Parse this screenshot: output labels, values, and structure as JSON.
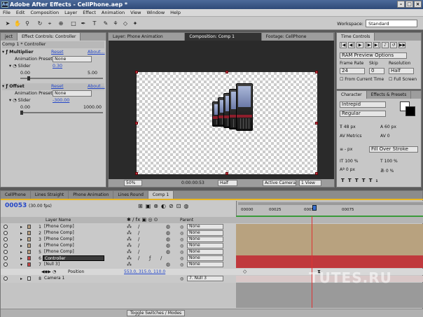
{
  "app": {
    "title": "Adobe After Effects - CellPhone.aep *",
    "icon_text": "Ae"
  },
  "menu": [
    "File",
    "Edit",
    "Composition",
    "Layer",
    "Effect",
    "Animation",
    "View",
    "Window",
    "Help"
  ],
  "workspace": {
    "label": "Workspace:",
    "value": "Standard"
  },
  "effect_controls": {
    "tabs": [
      "ject",
      "Effect Controls: Controller"
    ],
    "header": "Comp 1 * Controller",
    "effects": [
      {
        "name": "Multiplier",
        "reset": "Reset",
        "about": "About...",
        "preset_label": "Animation Presets:",
        "preset_value": "None",
        "param": "Slider",
        "value": "0.30",
        "min": "0.00",
        "max": "5.00"
      },
      {
        "name": "Offset",
        "reset": "Reset",
        "about": "About...",
        "preset_label": "Animation Presets:",
        "preset_value": "None",
        "param": "Slider",
        "value": "-300.00",
        "min": "0.00",
        "max": "1000.00"
      }
    ]
  },
  "viewer": {
    "tabs": [
      "Layer: Phone Animation",
      "Composition: Comp 1",
      "Footage: CellPhone"
    ],
    "zoom": "50%",
    "timecode": "0:00:00:53",
    "resolution": "Half",
    "camera": "Active Camera",
    "views": "1 View"
  },
  "time_controls": {
    "tab": "Time Controls",
    "preview_label": "RAM Preview Options",
    "frame_rate_label": "Frame Rate",
    "skip_label": "Skip",
    "resolution_label": "Resolution",
    "frame_rate": "24",
    "skip": "0",
    "resolution": "Half",
    "from_current": "From Current Time",
    "full_screen": "Full Screen"
  },
  "character": {
    "tabs": [
      "Character",
      "Effects & Presets"
    ],
    "font": "Intrepid",
    "style": "Regular",
    "size": "48 px",
    "leading": "60 px",
    "kerning": "Metrics",
    "tracking": "0",
    "stroke_width": "- px",
    "stroke_mode": "Fill Over Stroke",
    "vscale": "100 %",
    "hscale": "100 %",
    "baseline": "0 px",
    "tsume": "0 %"
  },
  "timeline": {
    "tabs": [
      "CellPhone",
      "Lines Straight",
      "Phone Animation",
      "Lines Round",
      "Comp 1"
    ],
    "time": "00053",
    "fps": "(30.00 fps)",
    "col_layer": "Layer Name",
    "col_parent": "Parent",
    "ruler": [
      "00000",
      "00025",
      "00050",
      "00075"
    ],
    "layers": [
      {
        "num": "1",
        "name": "[Phone Comp]",
        "parent": "None",
        "color": "#b9a182",
        "bar": "#b8a27f"
      },
      {
        "num": "2",
        "name": "[Phone Comp]",
        "parent": "None",
        "color": "#b9a182",
        "bar": "#b8a27f"
      },
      {
        "num": "3",
        "name": "[Phone Comp]",
        "parent": "None",
        "color": "#b9a182",
        "bar": "#b8a27f"
      },
      {
        "num": "4",
        "name": "[Phone Comp]",
        "parent": "None",
        "color": "#b9a182",
        "bar": "#b8a27f"
      },
      {
        "num": "5",
        "name": "[Phone Comp]",
        "parent": "None",
        "color": "#b9a182",
        "bar": "#b8a27f"
      },
      {
        "num": "6",
        "name": "Controller",
        "parent": "None",
        "color": "#c44242",
        "bar": "#c0393d",
        "selected": true
      },
      {
        "num": "7",
        "name": "[Null 3]",
        "parent": "None",
        "color": "#c44242",
        "bar": "#c0393d"
      }
    ],
    "position": {
      "label": "Position",
      "value": "553.0, 315.0, 110.0"
    },
    "camera": {
      "num": "8",
      "name": "Camera 1",
      "parent": "7. Null 3"
    },
    "toggle_label": "Toggle Switches / Modes"
  },
  "watermark": "TUTES.RU"
}
